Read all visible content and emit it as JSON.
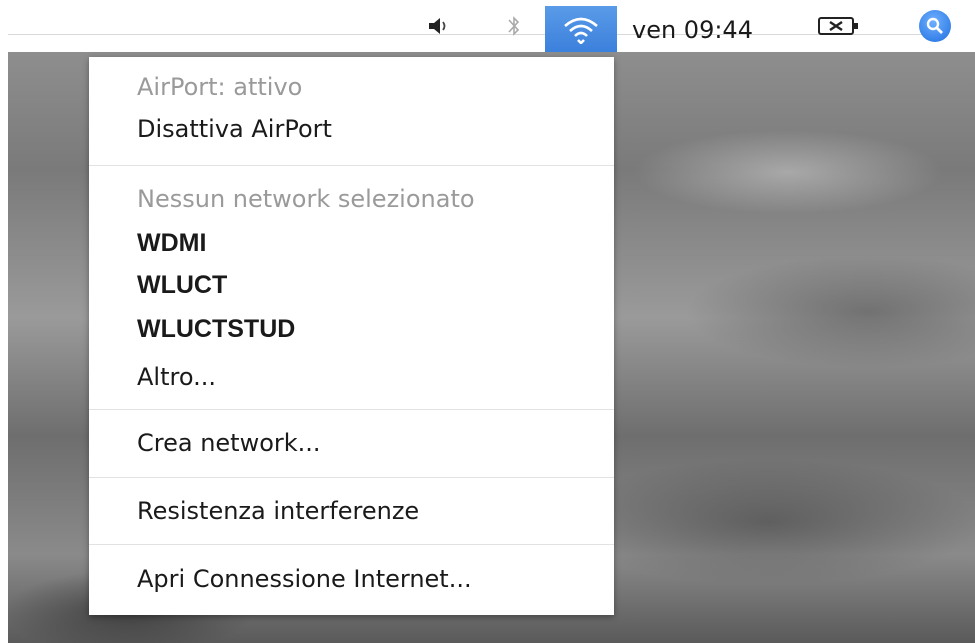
{
  "menubar": {
    "clock": "ven 09:44",
    "icons": {
      "volume": "volume-icon",
      "bluetooth": "bluetooth-icon",
      "wifi": "wifi-icon",
      "battery": "battery-icon",
      "spotlight": "spotlight-search-icon"
    },
    "colors": {
      "wifi_highlight": "#3b80dc",
      "spotlight": "#1f6fe0"
    }
  },
  "airport_menu": {
    "status": "AirPort: attivo",
    "toggle": "Disattiva AirPort",
    "network_status": "Nessun network selezionato",
    "networks": [
      "WDMI",
      "WLUCT",
      "WLUCTSTUD"
    ],
    "other": "Altro...",
    "create_network": "Crea network...",
    "interference": "Resistenza interferenze",
    "open_internet": "Apri Connessione Internet..."
  }
}
